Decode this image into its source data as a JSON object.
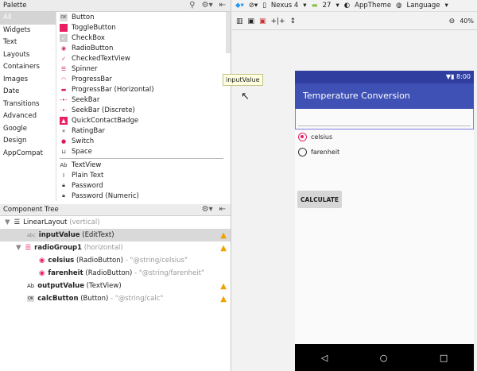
{
  "palette": {
    "title": "Palette",
    "categories": [
      "All",
      "Widgets",
      "Text",
      "Layouts",
      "Containers",
      "Images",
      "Date",
      "Transitions",
      "Advanced",
      "Google",
      "Design",
      "AppCompat"
    ],
    "items": [
      {
        "label": "Button",
        "icon": "ok-button-icon"
      },
      {
        "label": "ToggleButton",
        "icon": "toggle-icon"
      },
      {
        "label": "CheckBox",
        "icon": "checkbox-icon"
      },
      {
        "label": "RadioButton",
        "icon": "radio-icon"
      },
      {
        "label": "CheckedTextView",
        "icon": "checked-text-icon"
      },
      {
        "label": "Spinner",
        "icon": "spinner-icon"
      },
      {
        "label": "ProgressBar",
        "icon": "progress-icon"
      },
      {
        "label": "ProgressBar (Horizontal)",
        "icon": "progress-horizontal-icon"
      },
      {
        "label": "SeekBar",
        "icon": "seekbar-icon"
      },
      {
        "label": "SeekBar (Discrete)",
        "icon": "seekbar-discrete-icon"
      },
      {
        "label": "QuickContactBadge",
        "icon": "contact-icon"
      },
      {
        "label": "RatingBar",
        "icon": "star-icon"
      },
      {
        "label": "Switch",
        "icon": "switch-icon"
      },
      {
        "label": "Space",
        "icon": "space-icon"
      }
    ],
    "text_items": [
      {
        "label": "TextView",
        "icon": "Ab"
      },
      {
        "label": "Plain Text",
        "icon": "I"
      },
      {
        "label": "Password",
        "icon": "lock"
      },
      {
        "label": "Password (Numeric)",
        "icon": "lock"
      }
    ]
  },
  "tree": {
    "title": "Component Tree",
    "rows": [
      {
        "name": "LinearLayout",
        "type": "(vertical)",
        "extra": ""
      },
      {
        "name": "inputValue",
        "type": "(EditText)",
        "extra": ""
      },
      {
        "name": "radioGroup1",
        "type": "(horizontal)",
        "extra": ""
      },
      {
        "name": "celsius",
        "type": "(RadioButton)",
        "extra": "- \"@string/celsius\""
      },
      {
        "name": "farenheit",
        "type": "(RadioButton)",
        "extra": "- \"@string/farenheit\""
      },
      {
        "name": "outputValue",
        "type": "(TextView)",
        "extra": ""
      },
      {
        "name": "calcButton",
        "type": "(Button)",
        "extra": "- \"@string/calc\""
      }
    ]
  },
  "toolbar": {
    "device": "Nexus 4",
    "api": "27",
    "theme": "AppTheme",
    "language": "Language",
    "zoom": "40%"
  },
  "tooltip": "inputValue",
  "phone": {
    "time": "8:00",
    "title": "Temperature Conversion",
    "radio1": "celsius",
    "radio2": "farenheit",
    "button": "CALCULATE",
    "accent": "#e91e63",
    "primary": "#3f51b5"
  }
}
